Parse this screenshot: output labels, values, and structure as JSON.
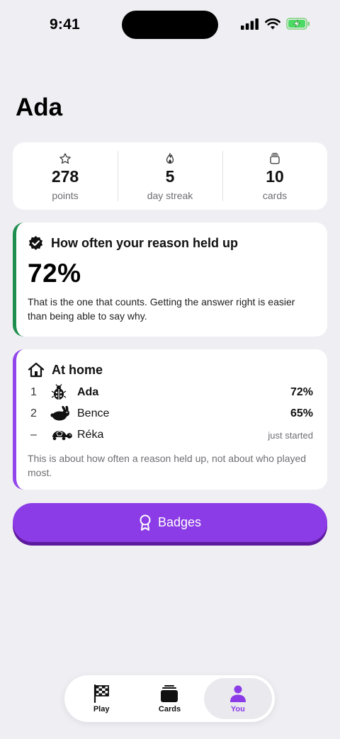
{
  "status_bar": {
    "time": "9:41"
  },
  "page": {
    "title": "Ada"
  },
  "stats": [
    {
      "icon": "star-icon",
      "value": "278",
      "label": "points"
    },
    {
      "icon": "flame-icon",
      "value": "5",
      "label": "day streak"
    },
    {
      "icon": "cards-stack-icon",
      "value": "10",
      "label": "cards"
    }
  ],
  "reason_card": {
    "icon": "verified-badge-icon",
    "title": "How often your reason held up",
    "value": "72%",
    "description": "That is the one that counts. Getting the answer right is easier than being able to say why.",
    "accent_color": "#1E8E4E"
  },
  "home_card": {
    "icon": "house-icon",
    "title": "At home",
    "accent_color": "#9146EB",
    "rows": [
      {
        "position": "1",
        "avatar": "ladybug-icon",
        "name": "Ada",
        "value": "72%"
      },
      {
        "position": "2",
        "avatar": "rabbit-icon",
        "name": "Bence",
        "value": "65%"
      },
      {
        "position": "–",
        "avatar": "turtle-icon",
        "name": "Réka",
        "value": "just started"
      }
    ],
    "note": "This is about how often a reason held up, not about who played most."
  },
  "badges_button": {
    "icon": "ribbon-icon",
    "label": "Badges",
    "color": "#8B3CE6"
  },
  "tab_bar": {
    "tabs": [
      {
        "icon": "checkered-flag-icon",
        "label": "Play",
        "active": false
      },
      {
        "icon": "cards-icon",
        "label": "Cards",
        "active": false
      },
      {
        "icon": "person-icon",
        "label": "You",
        "active": true
      }
    ]
  }
}
